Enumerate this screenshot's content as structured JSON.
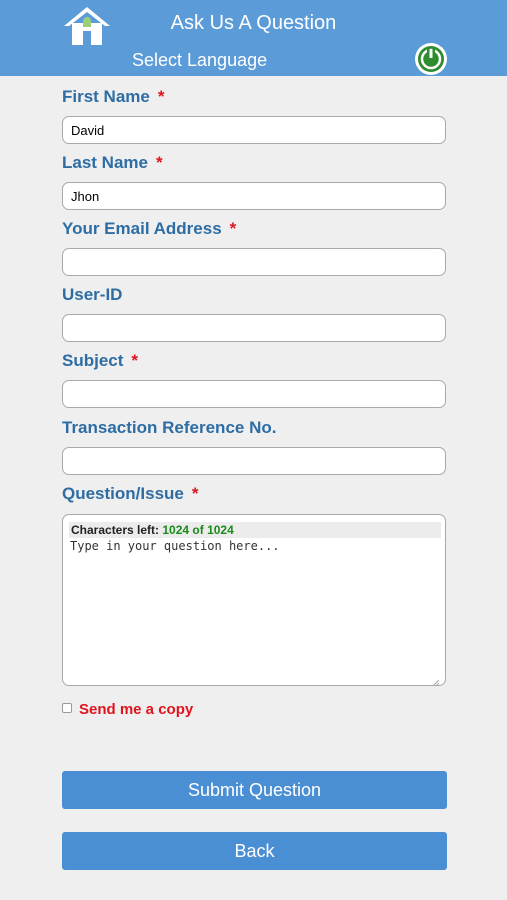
{
  "header": {
    "title": "Ask Us A Question",
    "language_link": "Select Language",
    "icons": {
      "home": "home-icon",
      "power": "power-icon"
    },
    "colors": {
      "background": "#5a9bd8",
      "power_ring": "#2e8b2e"
    }
  },
  "form": {
    "first_name": {
      "label": "First Name",
      "required_mark": "*",
      "value": "David"
    },
    "last_name": {
      "label": "Last Name",
      "required_mark": "*",
      "value": "Jhon"
    },
    "email": {
      "label": "Your Email Address",
      "required_mark": "*",
      "value": ""
    },
    "user_id": {
      "label": "User-ID",
      "value": ""
    },
    "subject": {
      "label": "Subject",
      "required_mark": "*",
      "value": ""
    },
    "transaction_ref": {
      "label": "Transaction Reference No.",
      "value": ""
    },
    "question": {
      "label": "Question/Issue",
      "required_mark": "*",
      "counter_label": "Characters left:",
      "counter_value": "1024 of 1024",
      "placeholder": "Type in your question here..."
    },
    "send_copy": {
      "label": "Send me a copy",
      "checked": false
    }
  },
  "buttons": {
    "submit": "Submit Question",
    "back": "Back"
  },
  "colors": {
    "label": "#2e6da4",
    "required": "#e0141e",
    "counter": "#1a8a1a",
    "button": "#4a8fd4",
    "page_background": "#efefef"
  }
}
